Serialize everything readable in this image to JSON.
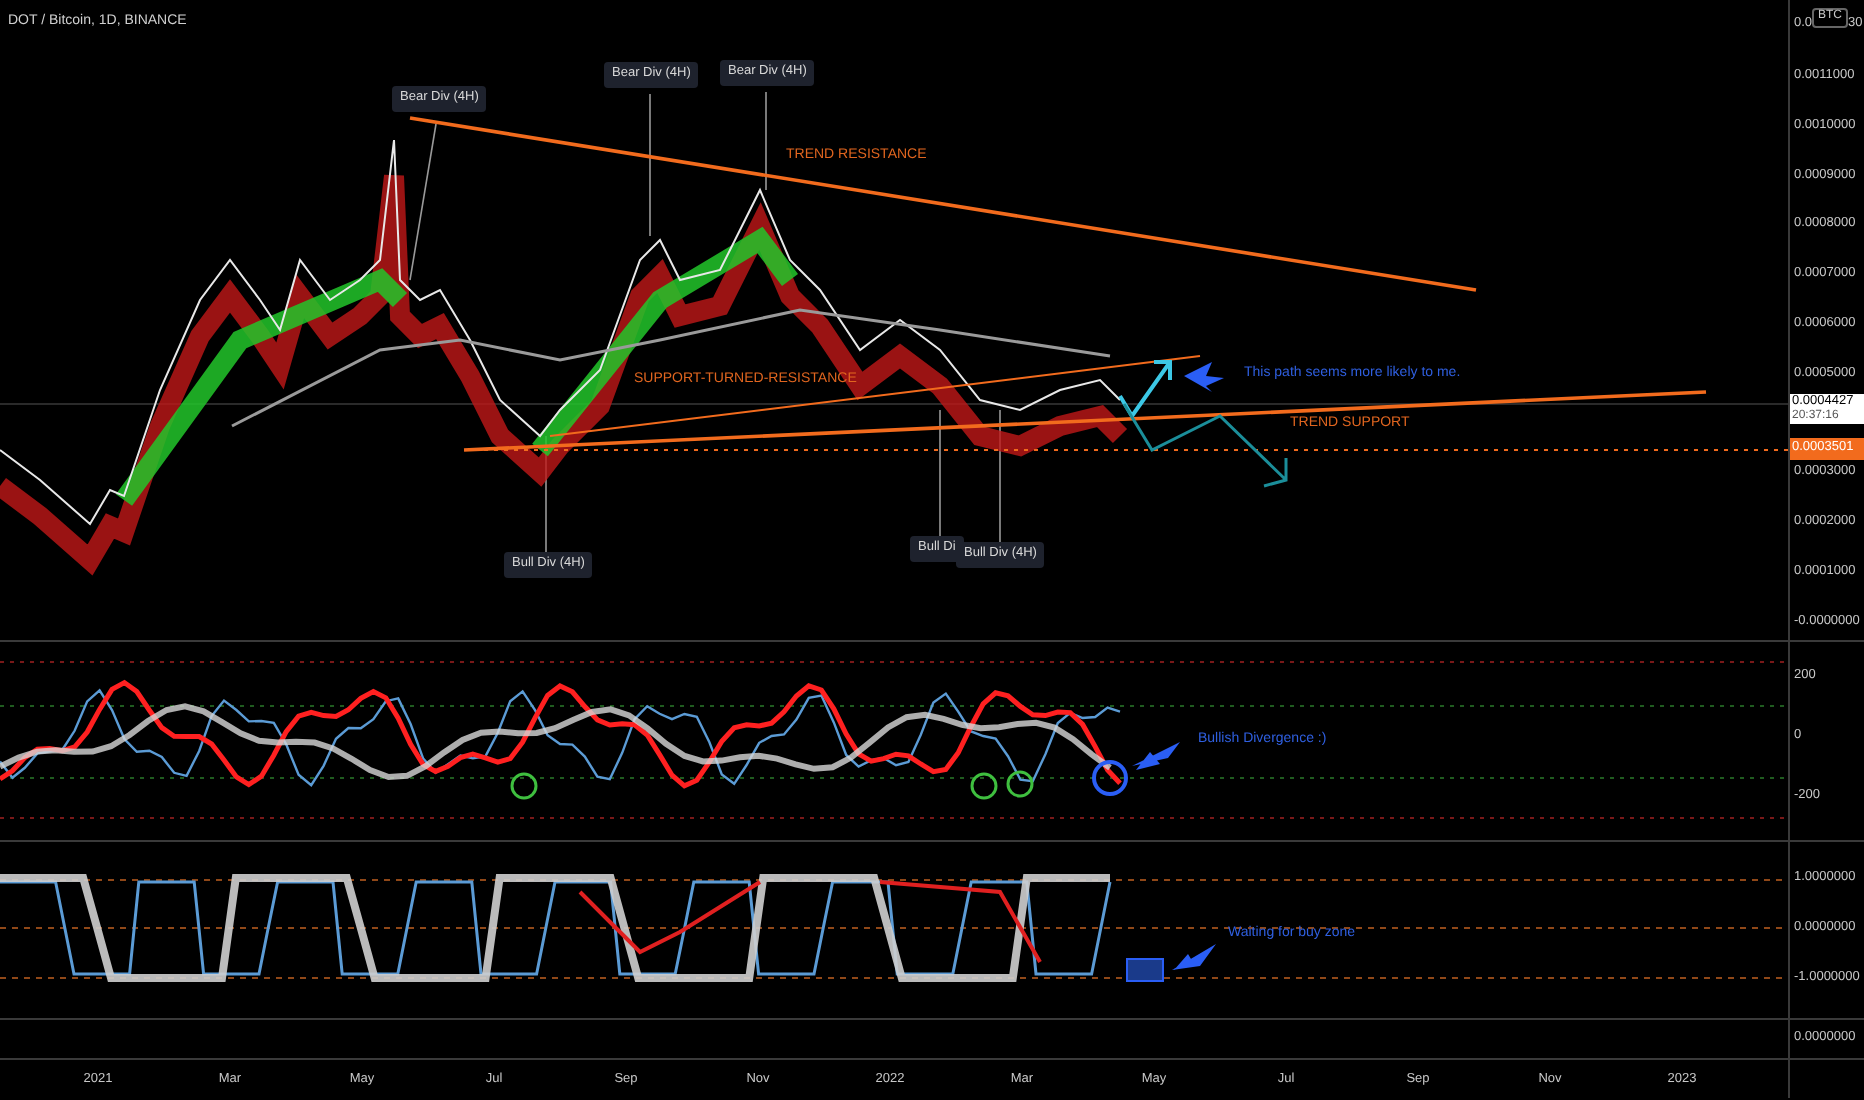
{
  "header": {
    "symbol": "DOT / Bitcoin, 1D, BINANCE",
    "currency": "BTC",
    "top_axis_start": "0.0",
    "top_axis_end": "30"
  },
  "price_pane": {
    "axis_labels": [
      "0.0011000",
      "0.0010000",
      "0.0009000",
      "0.0008000",
      "0.0007000",
      "0.0006000",
      "0.0005000",
      "0.0003000",
      "0.0002000",
      "0.0001000",
      "-0.0000000"
    ],
    "last_price": {
      "value": "0.0004427",
      "countdown": "20:37:16"
    },
    "line_price": "0.0003501",
    "div_tags": [
      {
        "text": "Bear Div (4H)"
      },
      {
        "text": "Bear Div (4H)"
      },
      {
        "text": "Bear Div (4H)"
      },
      {
        "text": "Bull Div (4H)"
      },
      {
        "text": "Bull Di"
      },
      {
        "text": "Bull Div (4H)"
      }
    ],
    "notes": [
      {
        "kind": "orange",
        "text": "TREND RESISTANCE"
      },
      {
        "kind": "orange",
        "text": "SUPPORT-TURNED-RESISTANCE"
      },
      {
        "kind": "blue",
        "text": "This path seems more likely to me."
      },
      {
        "kind": "orange",
        "text": "TREND SUPPORT"
      }
    ]
  },
  "oscillator_pane": {
    "axis_labels": [
      "200",
      "0",
      "-200"
    ],
    "note": "Bullish Divergence :)"
  },
  "stoch_pane": {
    "axis_labels": [
      "1.0000000",
      "0.0000000",
      "-1.0000000"
    ],
    "note": "Waiting for buy zone"
  },
  "bottom_pane": {
    "axis_labels": [
      "0.0000000"
    ]
  },
  "time_axis": [
    "2021",
    "Mar",
    "May",
    "Jul",
    "Sep",
    "Nov",
    "2022",
    "Mar",
    "May",
    "Jul",
    "Sep",
    "Nov",
    "2023"
  ]
}
